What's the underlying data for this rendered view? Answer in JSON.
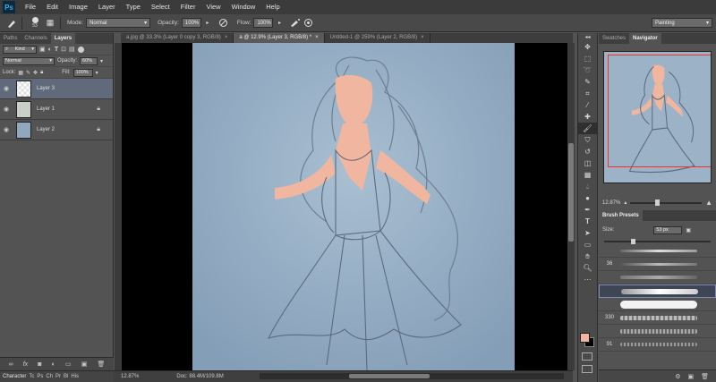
{
  "app": {
    "logo": "Ps"
  },
  "menu": [
    "File",
    "Edit",
    "Image",
    "Layer",
    "Type",
    "Select",
    "Filter",
    "View",
    "Window",
    "Help"
  ],
  "options": {
    "brush_size": "53",
    "mode_label": "Mode:",
    "mode_value": "Normal",
    "opacity_label": "Opacity:",
    "opacity_value": "100%",
    "flow_label": "Flow:",
    "flow_value": "100%",
    "workspace": "Painting"
  },
  "tabs": [
    {
      "label": "a.jpg @ 33.3% (Layer 0 copy 3, RGB/8)",
      "active": false
    },
    {
      "label": "a @ 12.9% (Layer 3, RGB/8) *",
      "active": true
    },
    {
      "label": "Untitled-1 @ 259% (Layer 2, RGB/8)",
      "active": false
    }
  ],
  "layers_panel": {
    "tabs": [
      "Paths",
      "Channels",
      "Layers"
    ],
    "kind_label": "Kind",
    "blend_mode": "Normal",
    "opacity_label": "Opacity:",
    "opacity_value": "60%",
    "lock_label": "Lock:",
    "fill_label": "Fill:",
    "fill_value": "100%",
    "layers": [
      {
        "name": "Layer 3",
        "selected": true,
        "locked": false
      },
      {
        "name": "Layer 1",
        "selected": false,
        "locked": true
      },
      {
        "name": "Layer 2",
        "selected": false,
        "locked": true
      }
    ]
  },
  "status": {
    "character_tab": "Character",
    "char_tabs": [
      "Tc",
      "Ps",
      "Ch",
      "Pr",
      "Bl",
      "His"
    ],
    "zoom": "12.87%",
    "doc": "Doc: 88.4M/109.8M"
  },
  "navigator": {
    "tabs": [
      "Swatches",
      "Navigator"
    ],
    "zoom": "12.87%"
  },
  "brush_presets": {
    "title": "Brush Presets",
    "size_label": "Size:",
    "size_value": "53 px",
    "rows": [
      "",
      "36",
      "",
      "",
      "",
      "330",
      "",
      "91"
    ]
  },
  "colors": {
    "foreground": "#f0b6a0",
    "background": "#000000",
    "canvas": "#8fa8bf",
    "skin": "#f0b6a0",
    "accent": "#38b0f0"
  },
  "icons": [
    "brush-icon",
    "eye-icon",
    "lock-icon",
    "airbrush-icon",
    "pressure-icon",
    "close-icon"
  ]
}
